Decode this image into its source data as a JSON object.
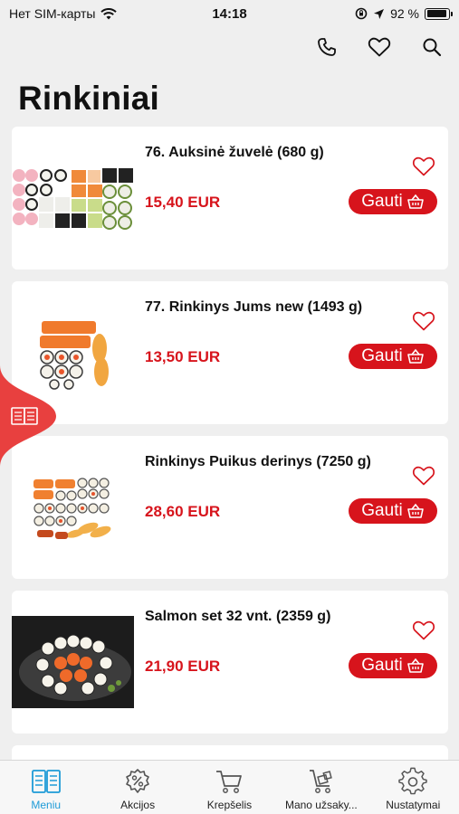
{
  "status_bar": {
    "carrier": "Нет SIM-карты",
    "time": "14:18",
    "battery_percent": "92 %",
    "battery_level": 0.92
  },
  "header": {
    "phone_icon": "phone-icon",
    "favorites_icon": "heart-icon",
    "search_icon": "search-icon"
  },
  "page": {
    "title": "Rinkiniai"
  },
  "products": [
    {
      "title": "76. Auksinė žuvelė (680 g)",
      "price": "15,40 EUR",
      "button": "Gauti"
    },
    {
      "title": "77. Rinkinys Jums new (1493 g)",
      "price": "13,50 EUR",
      "button": "Gauti"
    },
    {
      "title": "Rinkinys Puikus derinys (7250 g)",
      "price": "28,60 EUR",
      "button": "Gauti"
    },
    {
      "title": "Salmon set 32 vnt. (2359 g)",
      "price": "21,90 EUR",
      "button": "Gauti"
    }
  ],
  "tabs": [
    {
      "label": "Meniu",
      "icon": "menu-book-icon",
      "active": true
    },
    {
      "label": "Akcijos",
      "icon": "discount-icon",
      "active": false
    },
    {
      "label": "Krepšelis",
      "icon": "cart-icon",
      "active": false
    },
    {
      "label": "Mano užsaky...",
      "icon": "orders-cart-icon",
      "active": false
    },
    {
      "label": "Nustatymai",
      "icon": "gear-icon",
      "active": false
    }
  ],
  "colors": {
    "accent": "#d7141c",
    "tab_active": "#1e9bd7",
    "background": "#efefef"
  }
}
